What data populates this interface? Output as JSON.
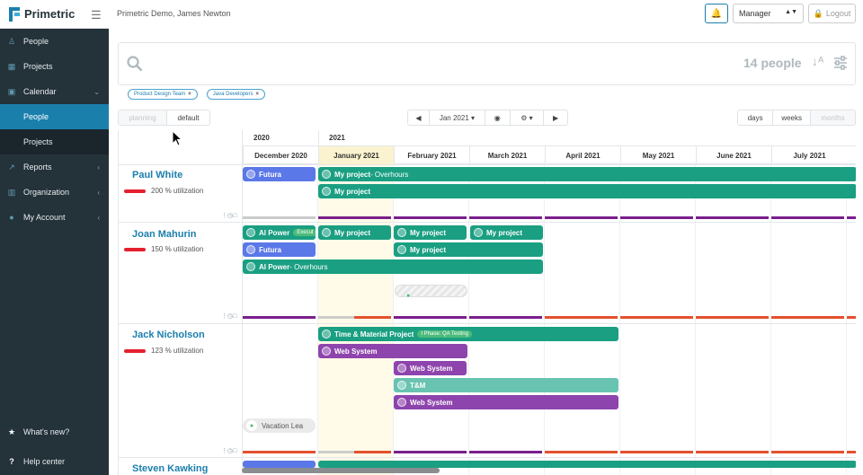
{
  "app": {
    "name": "Primetric"
  },
  "topbar": {
    "title": "Primetric Demo, James Newton",
    "role": "Manager",
    "logout": "Logout"
  },
  "sidebar": {
    "items": [
      {
        "label": "People",
        "icon": "people-icon"
      },
      {
        "label": "Projects",
        "icon": "projects-icon"
      },
      {
        "label": "Calendar",
        "icon": "calendar-icon"
      },
      {
        "label": "People",
        "icon": ""
      },
      {
        "label": "Projects",
        "icon": ""
      },
      {
        "label": "Reports",
        "icon": "reports-icon"
      },
      {
        "label": "Organization",
        "icon": "organization-icon"
      },
      {
        "label": "My Account",
        "icon": "account-icon"
      }
    ],
    "bottom": [
      {
        "label": "What's new?",
        "icon": "star-icon"
      },
      {
        "label": "Help center",
        "icon": "question-icon"
      }
    ]
  },
  "search": {
    "count": "14 people"
  },
  "filters": [
    "Product Design Team",
    "Java Developers"
  ],
  "views": {
    "planning": "planning",
    "default": "default"
  },
  "nav": {
    "date": "Jan 2021"
  },
  "scale": {
    "days": "days",
    "weeks": "weeks",
    "months": "months"
  },
  "years": [
    "2020",
    "2021"
  ],
  "months": [
    "December 2020",
    "January 2021",
    "February 2021",
    "March 2021",
    "April 2021",
    "May 2021",
    "June 2021",
    "July 2021"
  ],
  "people": [
    {
      "name": "Paul White",
      "util_value": "200",
      "util_label": "% utilization"
    },
    {
      "name": "Joan Mahurin",
      "util_value": "150",
      "util_label": "% utilization"
    },
    {
      "name": "Jack Nicholson",
      "util_value": "123",
      "util_label": "% utilization"
    },
    {
      "name": "Steven Kawking"
    }
  ],
  "bookings": {
    "futura": "Futura",
    "myproject": "My project",
    "overhours": " - Overhours",
    "aipower": "AI Power",
    "aipower_tag": "Execut",
    "tm_project": "Time & Material Project",
    "phase": "I Phase: QA Testing",
    "websystem": "Web System",
    "tm": "T&M",
    "vacation": "Vacation Lea"
  },
  "colors": {
    "accent": "#1b7fac",
    "sidebar": "#243239",
    "teal": "#1a9f82",
    "blue": "#5b78e8",
    "purple": "#8e44ad",
    "over": "#e4202e"
  }
}
